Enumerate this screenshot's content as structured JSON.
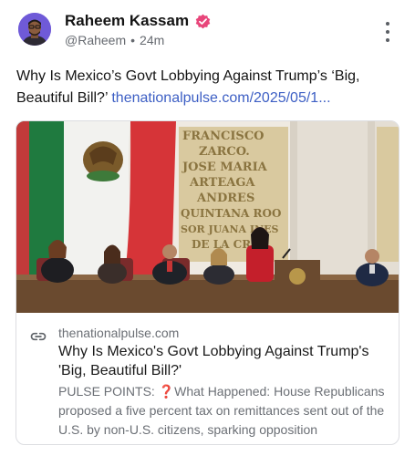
{
  "post": {
    "author_name": "Raheem Kassam",
    "handle": "@Raheem",
    "separator": "•",
    "time_ago": "24m",
    "text": "Why Is Mexico’s Govt Lobbying Against Trump’s ‘Big, Beautiful Bill?’ ",
    "link_text": "thenationalpulse.com/2025/05/1..."
  },
  "card": {
    "domain": "thenationalpulse.com",
    "title": "Why Is Mexico's Govt Lobbying Against Trump's 'Big, Beautiful Bill?'",
    "description": "PULSE POINTS: ❓What Happened: House Republicans proposed a five percent tax on remittances sent out of the U.S. by non-U.S. citizens, sparking opposition",
    "wall_inscription": [
      "FRANCISCO",
      "ZARCO.",
      "JOSE MARIA",
      "ARTEAGA",
      "ANDRES",
      "QUINTANA ROO",
      "SOR JUANA INES",
      "DE LA CRUZ"
    ]
  },
  "colors": {
    "verified_badge": "#e8457a",
    "link": "#3d5fc4",
    "avatar_bg": "#6f5ad8"
  },
  "icons": {
    "verified": "verified-badge-icon",
    "more": "more-options-icon",
    "link": "link-icon"
  }
}
